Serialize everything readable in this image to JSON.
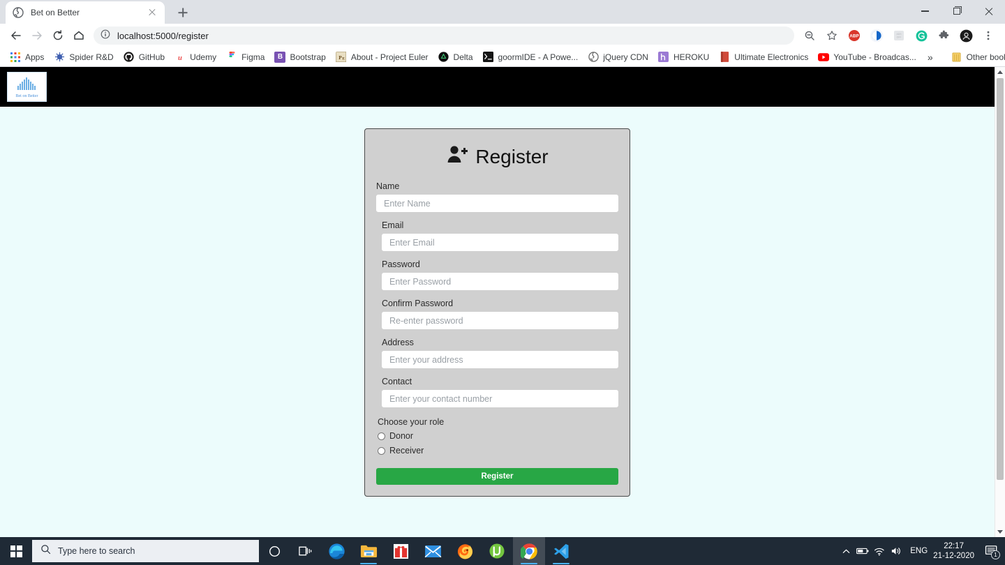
{
  "browser": {
    "tab": {
      "title": "Bet on Better",
      "favicon": "globe-icon"
    },
    "newtab_label": "+",
    "window_controls": {
      "minimize": "minimize-icon",
      "maximize": "maximize-icon",
      "close": "close-icon"
    },
    "nav": {
      "back": "back-arrow-icon",
      "forward": "forward-arrow-icon",
      "reload": "reload-icon",
      "home": "home-icon"
    },
    "omnibox": {
      "security": "info-icon",
      "url": "localhost:5000/register"
    },
    "toolbar_icons": [
      "zoom-out-icon",
      "bookmark-star-icon",
      "adblock-plus-icon",
      "extension-blue-icon",
      "extension-gray-icon",
      "grammarly-icon",
      "extensions-puzzle-icon",
      "profile-avatar-icon",
      "chrome-menu-icon"
    ],
    "bookmarks": [
      {
        "label": "Apps",
        "icon": "apps-grid-icon",
        "color": "#4285f4"
      },
      {
        "label": "Spider R&D",
        "icon": "spider-icon",
        "color": "#4b6fbd"
      },
      {
        "label": "GitHub",
        "icon": "github-icon",
        "color": "#181717"
      },
      {
        "label": "Udemy",
        "icon": "udemy-icon",
        "color": "#ea5252"
      },
      {
        "label": "Figma",
        "icon": "figma-icon",
        "color": "#a259ff"
      },
      {
        "label": "Bootstrap",
        "icon": "bootstrap-icon",
        "color": "#7952b3"
      },
      {
        "label": "About - Project Euler",
        "icon": "project-euler-icon",
        "color": "#c9a227"
      },
      {
        "label": "Delta",
        "icon": "delta-icon",
        "color": "#111111"
      },
      {
        "label": "goormIDE - A Powe...",
        "icon": "terminal-icon",
        "color": "#1b1b1b"
      },
      {
        "label": "jQuery CDN",
        "icon": "globe-icon",
        "color": "#7a7a7a"
      },
      {
        "label": "HEROKU",
        "icon": "heroku-icon",
        "color": "#8f69c9"
      },
      {
        "label": "Ultimate Electronics",
        "icon": "book-icon",
        "color": "#d04a3a"
      },
      {
        "label": "YouTube - Broadcas...",
        "icon": "youtube-icon",
        "color": "#ff0000"
      }
    ],
    "bookmarks_overflow": "»",
    "other_bookmarks": {
      "label": "Other bookmarks",
      "icon": "folder-icon",
      "color": "#f4c542"
    }
  },
  "site": {
    "navbar": {
      "logo_text": "Bet on Better",
      "logo_mark": "▒▓▒",
      "background": "#000000"
    },
    "background": "#ecfcfc"
  },
  "register_form": {
    "title": "Register",
    "title_icon": "user-plus-icon",
    "fields": [
      {
        "label": "Name",
        "placeholder": "Enter Name",
        "value": "",
        "type": "text",
        "name": "name-field"
      },
      {
        "label": "Email",
        "placeholder": "Enter Email",
        "value": "",
        "type": "text",
        "name": "email-field"
      },
      {
        "label": "Password",
        "placeholder": "Enter Password",
        "value": "",
        "type": "password",
        "name": "password-field"
      },
      {
        "label": "Confirm Password",
        "placeholder": "Re-enter password",
        "value": "",
        "type": "password",
        "name": "confirm-password-field"
      },
      {
        "label": "Address",
        "placeholder": "Enter your address",
        "value": "",
        "type": "text",
        "name": "address-field"
      },
      {
        "label": "Contact",
        "placeholder": "Enter your contact number",
        "value": "",
        "type": "text",
        "name": "contact-field"
      }
    ],
    "role": {
      "legend": "Choose your role",
      "options": [
        {
          "label": "Donor",
          "selected": false
        },
        {
          "label": "Receiver",
          "selected": false
        }
      ]
    },
    "submit_label": "Register",
    "submit_color": "#28a745",
    "card_background": "#d0d0d0"
  },
  "taskbar": {
    "start": "windows-start-icon",
    "search_placeholder": "Type here to search",
    "cortana": "cortana-circle-icon",
    "task_view": "task-view-icon",
    "apps": [
      {
        "name": "microsoft-edge",
        "running": false
      },
      {
        "name": "file-explorer",
        "running": true
      },
      {
        "name": "gift-app",
        "running": false
      },
      {
        "name": "mail",
        "running": false
      },
      {
        "name": "firefox",
        "running": false
      },
      {
        "name": "utorrent",
        "running": false
      },
      {
        "name": "google-chrome",
        "running": true,
        "active": true
      },
      {
        "name": "visual-studio-code",
        "running": true
      }
    ],
    "tray": {
      "chevron": "show-hidden-icons",
      "icons": [
        "battery-icon",
        "wifi-icon",
        "volume-icon"
      ],
      "language": "ENG",
      "time": "22:17",
      "date": "21-12-2020",
      "notification_count": "1"
    }
  }
}
